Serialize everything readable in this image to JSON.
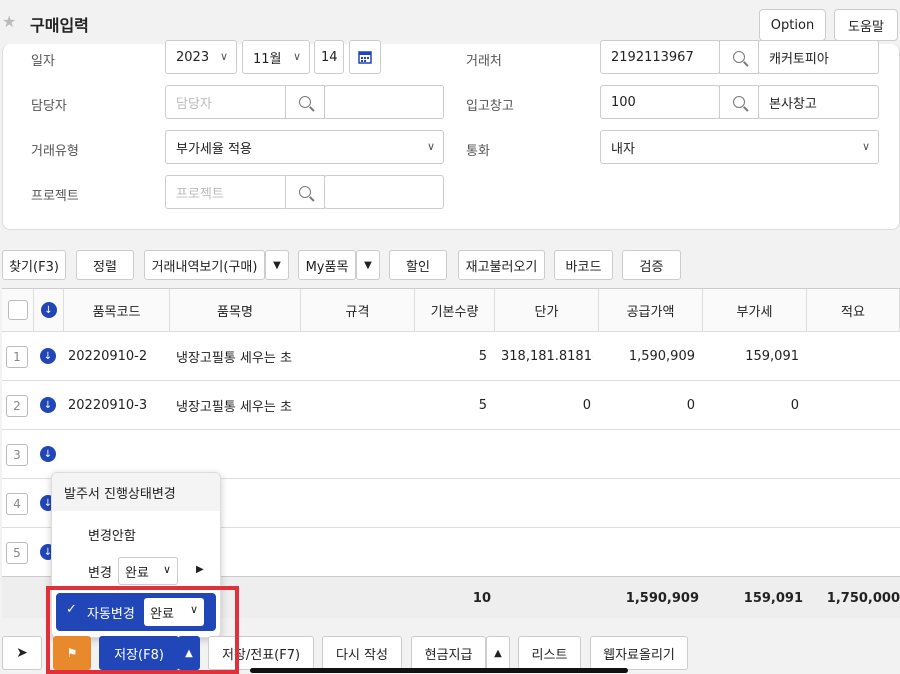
{
  "header": {
    "title": "구매입력",
    "option_label": "Option",
    "help_label": "도움말"
  },
  "form": {
    "date_label": "일자",
    "year": "2023",
    "month": "11월",
    "day": "14",
    "vendor_label": "거래처",
    "vendor_code": "2192113967",
    "vendor_name": "캐커토피아",
    "manager_label": "담당자",
    "manager_placeholder": "담당자",
    "warehouse_label": "입고창고",
    "warehouse_code": "100",
    "warehouse_name": "본사창고",
    "trade_type_label": "거래유형",
    "trade_type_value": "부가세율 적용",
    "currency_label": "통화",
    "currency_value": "내자",
    "project_label": "프로젝트",
    "project_placeholder": "프로젝트"
  },
  "toolbar": {
    "find": "찾기(F3)",
    "sort": "정렬",
    "history": "거래내역보기(구매)",
    "my_items": "My품목",
    "discount": "할인",
    "stock_load": "재고불러오기",
    "barcode": "바코드",
    "verify": "검증"
  },
  "grid": {
    "headers": [
      "품목코드",
      "품목명",
      "규격",
      "기본수량",
      "단가",
      "공급가액",
      "부가세",
      "적요"
    ],
    "rows": [
      {
        "no": "1",
        "code": "20220910-2",
        "name": "냉장고필통 세우는 초",
        "qty": "5",
        "price": "318,181.81818",
        "supply": "1,590,909",
        "vat": "159,091"
      },
      {
        "no": "2",
        "code": "20220910-3",
        "name": "냉장고필통 세우는 초",
        "qty": "5",
        "price": "0",
        "supply": "0",
        "vat": "0"
      },
      {
        "no": "3"
      },
      {
        "no": "4"
      },
      {
        "no": "5"
      }
    ],
    "totals": {
      "qty": "10",
      "supply": "1,590,909",
      "vat": "159,091",
      "total": "1,750,000"
    }
  },
  "popup": {
    "title": "발주서 진행상태변경",
    "no_change": "변경안함",
    "change": "변경",
    "change_value": "완료",
    "auto_change": "자동변경",
    "auto_value": "완료"
  },
  "bottom": {
    "save": "저장(F8)",
    "save_slip": "저장/전표(F7)",
    "rewrite": "다시 작성",
    "cash": "현금지급",
    "list": "리스트",
    "web_upload": "웹자료올리기"
  },
  "colors": {
    "accent": "#2146b8",
    "highlight": "#e0303c",
    "flag": "#e8892c"
  }
}
